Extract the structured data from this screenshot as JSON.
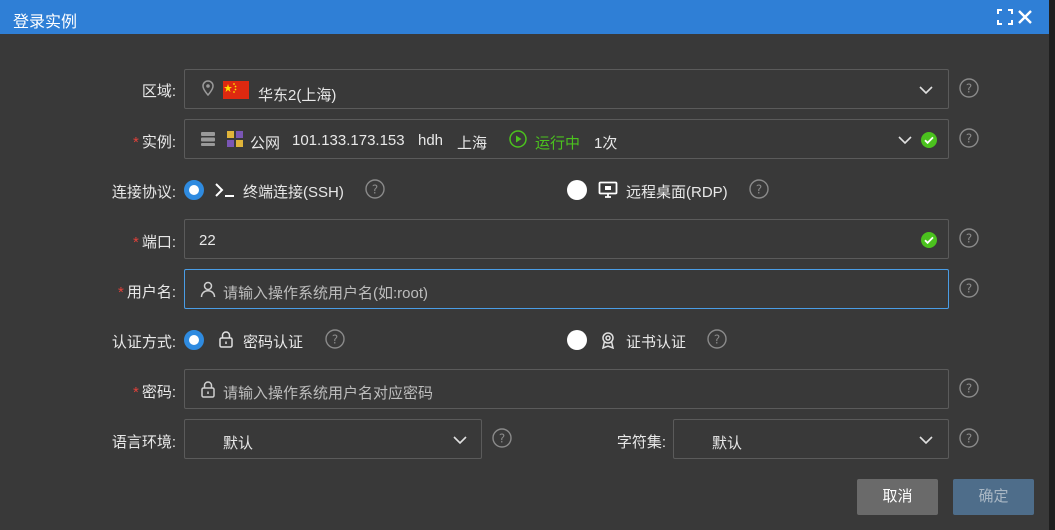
{
  "title": "登录实例",
  "region": {
    "label": "区域:",
    "value": "华东2(上海)"
  },
  "instance": {
    "label": "实例:",
    "network": "公网",
    "ip": "101.133.173.153",
    "name": "hdh",
    "city": "上海",
    "status": "运行中",
    "count": "1次"
  },
  "protocol": {
    "label": "连接协议:",
    "options": [
      {
        "label": "终端连接(SSH)",
        "selected": true
      },
      {
        "label": "远程桌面(RDP)",
        "selected": false
      }
    ]
  },
  "port": {
    "label": "端口:",
    "value": "22"
  },
  "username": {
    "label": "用户名:",
    "placeholder": "请输入操作系统用户名(如:root)"
  },
  "auth": {
    "label": "认证方式:",
    "options": [
      {
        "label": "密码认证",
        "selected": true
      },
      {
        "label": "证书认证",
        "selected": false
      }
    ]
  },
  "password": {
    "label": "密码:",
    "placeholder": "请输入操作系统用户名对应密码"
  },
  "language": {
    "label": "语言环境:",
    "value": "默认"
  },
  "charset": {
    "label": "字符集:",
    "value": "默认"
  },
  "buttons": {
    "cancel": "取消",
    "ok": "确定"
  },
  "required_mark": "*",
  "colors": {
    "accent": "#2f7fd6",
    "required": "#e2413a",
    "success": "#4bc21e"
  }
}
